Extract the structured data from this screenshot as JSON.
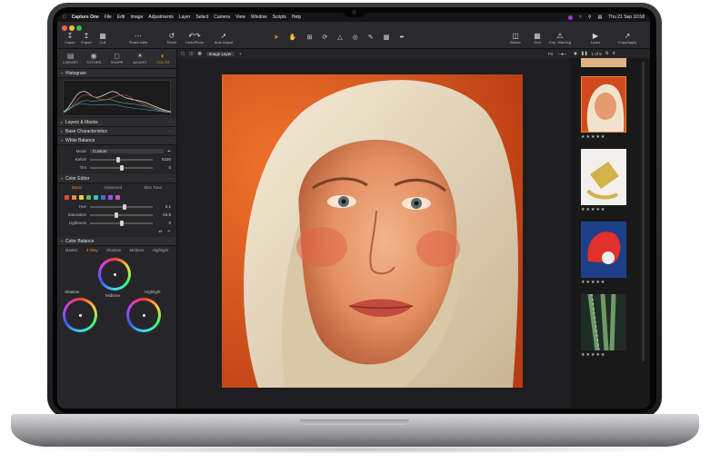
{
  "menubar": {
    "app_name": "Capture One",
    "items": [
      "File",
      "Edit",
      "Image",
      "Adjustments",
      "Layer",
      "Select",
      "Camera",
      "View",
      "Window",
      "Scripts",
      "Help"
    ],
    "datetime": "Thu 21 Sep  10:58"
  },
  "toolbar": {
    "buttons": [
      {
        "label": "Import",
        "icon": "import-icon"
      },
      {
        "label": "Export",
        "icon": "export-icon"
      },
      {
        "label": "Cull",
        "icon": "cull-icon"
      },
      {
        "label": "Share edits",
        "icon": "share-icon"
      },
      {
        "label": "Reset",
        "icon": "reset-icon"
      },
      {
        "label": "Undo/Redo",
        "icon": "undo-redo-icon"
      },
      {
        "label": "Auto Adjust",
        "icon": "auto-adjust-icon"
      }
    ],
    "cursor_tools_label": "Cursor Tools",
    "right_buttons": [
      {
        "label": "Before",
        "icon": "before-after-icon"
      },
      {
        "label": "Grid",
        "icon": "grid-icon"
      },
      {
        "label": "Exp. Warning",
        "icon": "exposure-warning-icon"
      },
      {
        "label": "Learn",
        "icon": "learn-icon"
      },
      {
        "label": "Copy/Apply",
        "icon": "copy-apply-icon"
      }
    ]
  },
  "tool_tabs": [
    {
      "label": "LIBRARY",
      "icon": "library-icon"
    },
    {
      "label": "TOTHER",
      "icon": "camera-icon"
    },
    {
      "label": "SHAPE",
      "icon": "shape-icon"
    },
    {
      "label": "ADJUST",
      "icon": "adjust-icon"
    },
    {
      "label": "COLOR",
      "icon": "color-icon",
      "active": true
    }
  ],
  "panels": {
    "histogram": "Histogram",
    "layers": "Layers & Masks",
    "base": "Base Characteristics",
    "white_balance": {
      "title": "White Balance",
      "mode_label": "Mode",
      "mode_value": "Custom",
      "kelvin_label": "Kelvin",
      "kelvin_value": "5320",
      "kelvin_level": 0.45,
      "tint_label": "Tint",
      "tint_value": "0",
      "tint_level": 0.5
    },
    "color_editor": {
      "title": "Color Editor",
      "tabs": [
        "Basic",
        "Advanced",
        "Skin Tone"
      ],
      "swatch_colors": [
        "#e04a3c",
        "#e9903a",
        "#e6d23c",
        "#56c24e",
        "#3bc0c6",
        "#3f6fe2",
        "#9a54e0",
        "#d94fb8"
      ],
      "hue_label": "Hue",
      "hue_value": "2.1",
      "hue_level": 0.55,
      "sat_label": "Saturation",
      "sat_value": "-16.5",
      "sat_level": 0.42,
      "light_label": "Lightness",
      "light_value": "0",
      "light_level": 0.5
    },
    "color_balance": {
      "title": "Color Balance",
      "tabs": [
        "Master",
        "3-Way",
        "Shadow",
        "Midtone",
        "Highlight"
      ],
      "midtone_label": "Midtone",
      "shadow_label": "Shadow",
      "highlight_label": "Highlight"
    }
  },
  "viewer": {
    "layer_select": "Image Layer",
    "fit_label": "Fit",
    "counter": "1 of 9"
  },
  "filmstrip": {
    "ratings": [
      "★★★★★",
      "★★★★★",
      "★★★★★",
      "★★★★★"
    ]
  }
}
